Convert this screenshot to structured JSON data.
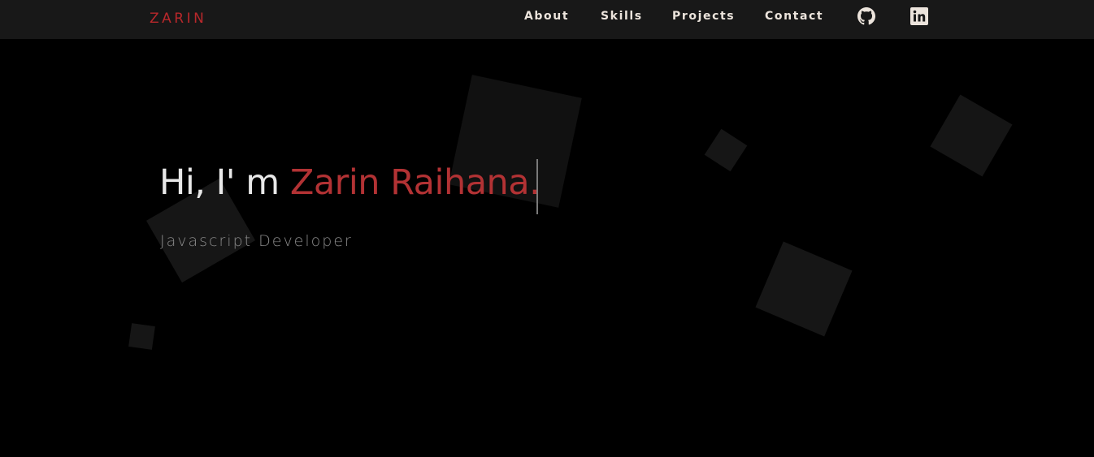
{
  "nav": {
    "brand": "ZARIN",
    "links": [
      {
        "label": "About"
      },
      {
        "label": "Skills"
      },
      {
        "label": "Projects"
      },
      {
        "label": "Contact"
      }
    ],
    "social": [
      {
        "icon": "github-icon"
      },
      {
        "icon": "linkedin-icon"
      }
    ]
  },
  "hero": {
    "greeting": "Hi, I' m ",
    "name": "Zarin Raihana.",
    "subtitle": "Javascript Developer"
  },
  "colors": {
    "accent": "#b23234",
    "background": "#000000",
    "navbar": "#181818",
    "nav_text": "#ece4dc"
  }
}
